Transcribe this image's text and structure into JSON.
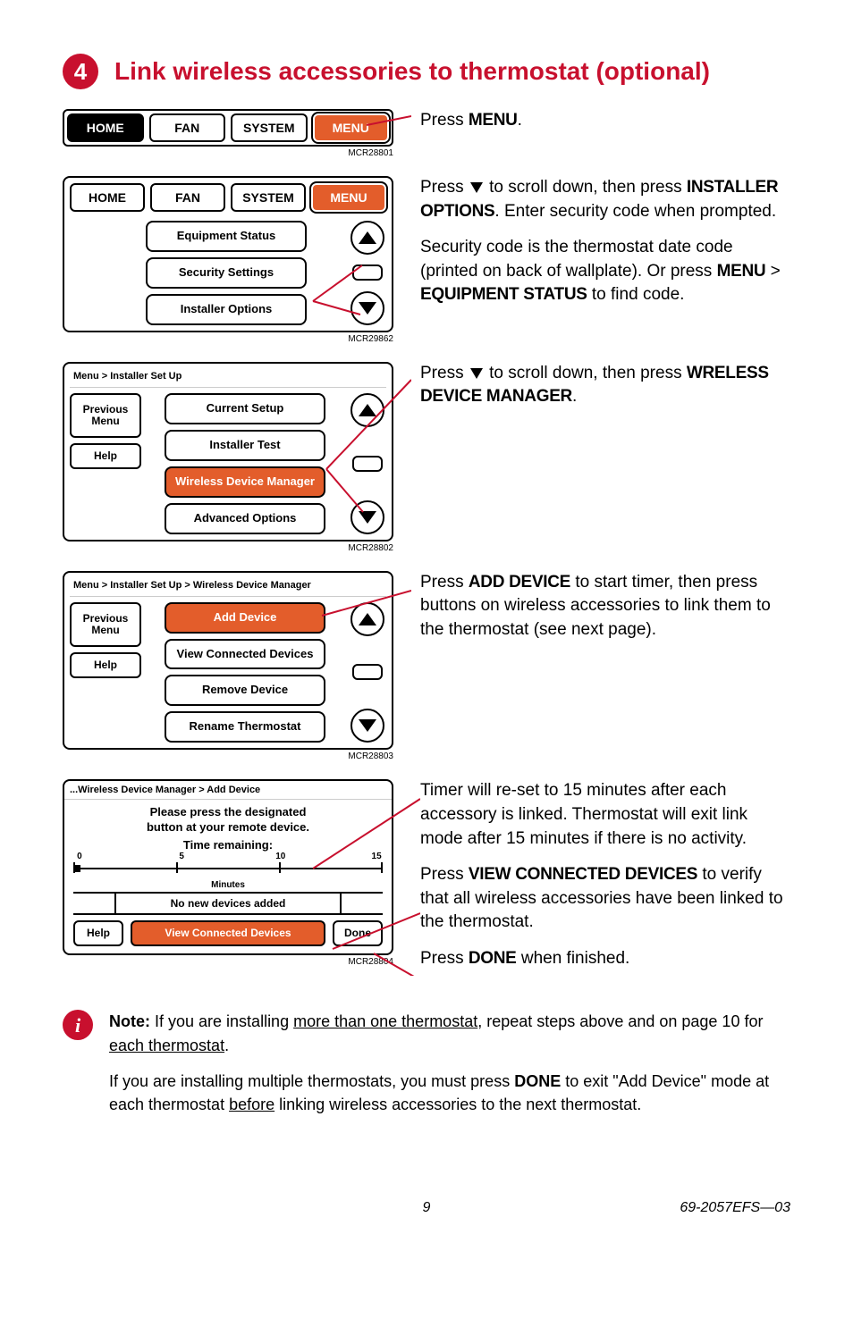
{
  "header": {
    "step_number": "4",
    "title": "Link wireless accessories to thermostat (optional)"
  },
  "fig1": {
    "tabs": {
      "home": "HOME",
      "fan": "FAN",
      "system": "SYSTEM",
      "menu": "MENU"
    },
    "ref": "MCR28801",
    "instr": {
      "p1_a": "Press ",
      "p1_b": "MENU",
      "p1_c": "."
    }
  },
  "fig2": {
    "tabs": {
      "home": "HOME",
      "fan": "FAN",
      "system": "SYSTEM",
      "menu": "MENU"
    },
    "items": {
      "a": "Equipment Status",
      "b": "Security Settings",
      "c": "Installer Options"
    },
    "ref": "MCR29862",
    "instr": {
      "p1_a": "Press ",
      "p1_b": " to scroll down, then press ",
      "p1_c": "INSTALLER OPTIONS",
      "p1_d": ". Enter security code when prompted.",
      "p2_a": "Security code is the thermostat date code (printed on back of wallplate). Or press ",
      "p2_b": "MENU",
      "p2_c": " > ",
      "p2_d": "EQUIPMENT STATUS",
      "p2_e": " to find code."
    }
  },
  "fig3": {
    "crumb": "Menu > Installer Set Up",
    "side": {
      "prev": "Previous Menu",
      "help": "Help"
    },
    "items": {
      "a": "Current Setup",
      "b": "Installer Test",
      "c": "Wireless Device Manager",
      "d": "Advanced Options"
    },
    "ref": "MCR28802",
    "instr": {
      "p1_a": "Press ",
      "p1_b": " to scroll down, then press ",
      "p1_c": "WRELESS DEVICE MANAGER",
      "p1_d": "."
    }
  },
  "fig4": {
    "crumb": "Menu > Installer Set Up > Wireless Device Manager",
    "side": {
      "prev": "Previous Menu",
      "help": "Help"
    },
    "items": {
      "a": "Add Device",
      "b": "View Connected Devices",
      "c": "Remove Device",
      "d": "Rename Thermostat"
    },
    "ref": "MCR28803",
    "instr": {
      "p1_a": "Press ",
      "p1_b": "ADD DEVICE",
      "p1_c": " to start timer, then press buttons on wireless accessories to link them to the thermostat (see next page)."
    }
  },
  "fig5": {
    "crumb": "...Wireless Device Manager > Add Device",
    "msg_l1": "Please press the designated",
    "msg_l2": "button at your remote device.",
    "time_label": "Time remaining:",
    "ticks": {
      "t0": "0",
      "t5": "5",
      "t10": "10",
      "t15": "15"
    },
    "minutes": "Minutes",
    "status": "No new devices added",
    "help": "Help",
    "view": "View Connected Devices",
    "done": "Done",
    "ref": "MCR28804",
    "instr": {
      "p1": "Timer will re-set to 15 minutes after each accessory is linked. Thermostat will exit link mode after 15 minutes if there is no activity.",
      "p2_a": "Press ",
      "p2_b": "VIEW CONNECTED DEVICES",
      "p2_c": " to verify that all wireless accessories have been linked to the thermostat.",
      "p3_a": "Press ",
      "p3_b": "DONE",
      "p3_c": " when finished."
    }
  },
  "note": {
    "label": "Note:",
    "p1_a": " If you are installing ",
    "p1_b": "more than one thermostat",
    "p1_c": ", repeat steps above and on page 10 for ",
    "p1_d": "each thermostat",
    "p1_e": ".",
    "p2_a": "If you are installing multiple thermostats, you must press ",
    "p2_b": "DONE",
    "p2_c": " to exit \"Add Device\" mode at each thermostat ",
    "p2_d": "before",
    "p2_e": " linking wireless accessories to the next thermostat."
  },
  "footer": {
    "page": "9",
    "doc": "69-2057EFS—03"
  }
}
